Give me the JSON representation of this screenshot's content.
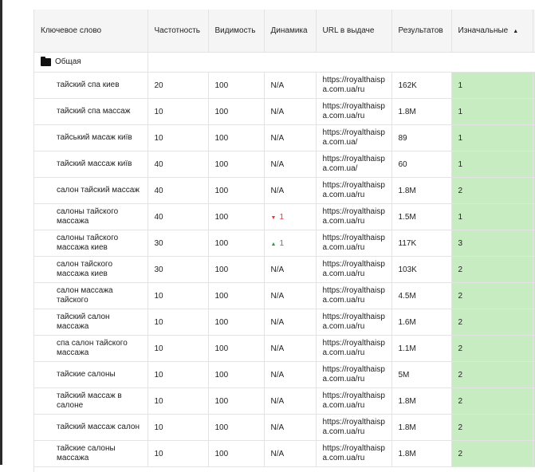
{
  "columns": {
    "keyword": "Ключевое слово",
    "frequency": "Частотность",
    "visibility": "Видимость",
    "dynamics": "Динамика",
    "url": "URL в выдаче",
    "results": "Результатов",
    "initial": "Изначальные"
  },
  "group": {
    "name": "Общая"
  },
  "rows": [
    {
      "keyword": "тайский спа киев",
      "frequency": "20",
      "visibility": "100",
      "dynamics": "N/A",
      "dyn_dir": "",
      "url": "https://royalthaispa.com.ua/ru",
      "results": "162K",
      "initial": "1"
    },
    {
      "keyword": "тайский спа массаж",
      "frequency": "10",
      "visibility": "100",
      "dynamics": "N/A",
      "dyn_dir": "",
      "url": "https://royalthaispa.com.ua/ru",
      "results": "1.8M",
      "initial": "1"
    },
    {
      "keyword": "тайський масаж київ",
      "frequency": "10",
      "visibility": "100",
      "dynamics": "N/A",
      "dyn_dir": "",
      "url": "https://royalthaispa.com.ua/",
      "results": "89",
      "initial": "1"
    },
    {
      "keyword": "тайский массаж київ",
      "frequency": "40",
      "visibility": "100",
      "dynamics": "N/A",
      "dyn_dir": "",
      "url": "https://royalthaispa.com.ua/",
      "results": "60",
      "initial": "1"
    },
    {
      "keyword": "салон тайский массаж",
      "frequency": "40",
      "visibility": "100",
      "dynamics": "N/A",
      "dyn_dir": "",
      "url": "https://royalthaispa.com.ua/ru",
      "results": "1.8M",
      "initial": "2"
    },
    {
      "keyword": "салоны тайского массажа",
      "frequency": "40",
      "visibility": "100",
      "dynamics": "1",
      "dyn_dir": "down",
      "url": "https://royalthaispa.com.ua/ru",
      "results": "1.5M",
      "initial": "1"
    },
    {
      "keyword": "салоны тайского массажа киев",
      "frequency": "30",
      "visibility": "100",
      "dynamics": "1",
      "dyn_dir": "up",
      "url": "https://royalthaispa.com.ua/ru",
      "results": "117K",
      "initial": "3"
    },
    {
      "keyword": "салон тайского массажа киев",
      "frequency": "30",
      "visibility": "100",
      "dynamics": "N/A",
      "dyn_dir": "",
      "url": "https://royalthaispa.com.ua/ru",
      "results": "103K",
      "initial": "2"
    },
    {
      "keyword": "салон массажа тайского",
      "frequency": "10",
      "visibility": "100",
      "dynamics": "N/A",
      "dyn_dir": "",
      "url": "https://royalthaispa.com.ua/ru",
      "results": "4.5M",
      "initial": "2"
    },
    {
      "keyword": "тайский салон массажа",
      "frequency": "10",
      "visibility": "100",
      "dynamics": "N/A",
      "dyn_dir": "",
      "url": "https://royalthaispa.com.ua/ru",
      "results": "1.6M",
      "initial": "2"
    },
    {
      "keyword": "спа салон тайского массажа",
      "frequency": "10",
      "visibility": "100",
      "dynamics": "N/A",
      "dyn_dir": "",
      "url": "https://royalthaispa.com.ua/ru",
      "results": "1.1M",
      "initial": "2"
    },
    {
      "keyword": "тайские салоны",
      "frequency": "10",
      "visibility": "100",
      "dynamics": "N/A",
      "dyn_dir": "",
      "url": "https://royalthaispa.com.ua/ru",
      "results": "5M",
      "initial": "2"
    },
    {
      "keyword": "тайский массаж в салоне",
      "frequency": "10",
      "visibility": "100",
      "dynamics": "N/A",
      "dyn_dir": "",
      "url": "https://royalthaispa.com.ua/ru",
      "results": "1.8M",
      "initial": "2"
    },
    {
      "keyword": "тайский массаж салон",
      "frequency": "10",
      "visibility": "100",
      "dynamics": "N/A",
      "dyn_dir": "",
      "url": "https://royalthaispa.com.ua/ru",
      "results": "1.8M",
      "initial": "2"
    },
    {
      "keyword": "тайские салоны массажа",
      "frequency": "10",
      "visibility": "100",
      "dynamics": "N/A",
      "dyn_dir": "",
      "url": "https://royalthaispa.com.ua/ru",
      "results": "1.8M",
      "initial": "2"
    }
  ],
  "colors": {
    "initial_cell_bg": "#c8ecc1",
    "header_bg": "#f5f5f5",
    "dyn_down": "#e53935",
    "dyn_up": "#2e9a4b"
  },
  "icons": {
    "group": "folder-icon",
    "sort": "sort-asc-icon",
    "dyn_down": "triangle-down-icon",
    "dyn_up": "triangle-up-icon"
  }
}
